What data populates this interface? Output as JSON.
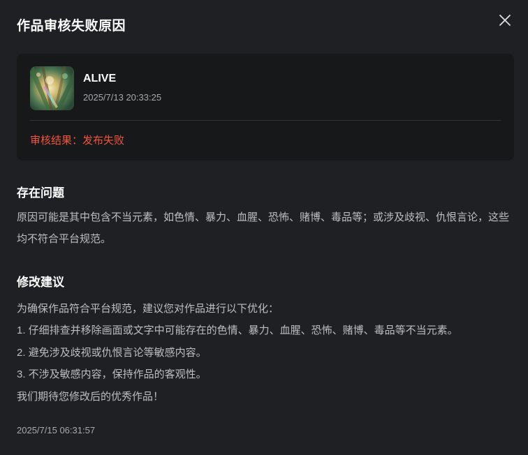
{
  "dialog": {
    "title": "作品审核失败原因",
    "close_icon": "close-icon"
  },
  "work": {
    "title": "ALIVE",
    "time": "2025/7/13 20:33:25",
    "result_label": "审核结果：",
    "result_value": "发布失败",
    "result_color": "#f0563c"
  },
  "problem": {
    "heading": "存在问题",
    "text": "原因可能是其中包含不当元素，如色情、暴力、血腥、恐怖、赌博、毒品等；或涉及歧视、仇恨言论，这些均不符合平台规范。"
  },
  "suggestion": {
    "heading": "修改建议",
    "intro": "为确保作品符合平台规范，建议您对作品进行以下优化：",
    "items": [
      "1. 仔细排查并移除画面或文字中可能存在的色情、暴力、血腥、恐怖、赌博、毒品等不当元素。",
      "2. 避免涉及歧视或仇恨言论等敏感内容。",
      "3. 不涉及敏感内容，保持作品的客观性。"
    ],
    "closing": "我们期待您修改后的优秀作品！"
  },
  "footer": {
    "time": "2025/7/15 06:31:57"
  }
}
